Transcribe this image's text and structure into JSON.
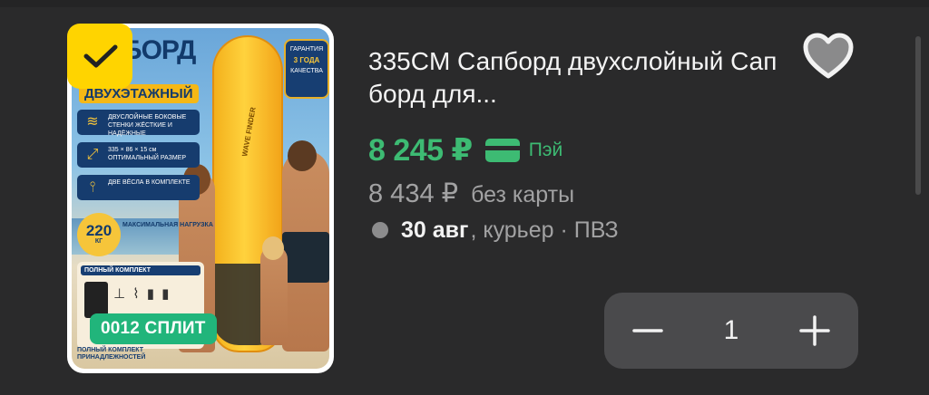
{
  "product": {
    "name": "335CM Сапборд двухслойный Сап борд для...",
    "price": "8 245 ₽",
    "pay_label": "Пэй",
    "old_price": "8 434 ₽",
    "old_price_label": "без карты",
    "delivery_date": "30 авг",
    "delivery_methods": ", курьер · ПВЗ",
    "split_badge": "0012 СПЛИТ",
    "quantity": "1"
  },
  "image": {
    "title_main": "БОРД",
    "title_sub": "ДВУХЭТАЖНЫЙ",
    "guarantee_top": "ГАРАНТИЯ",
    "guarantee_value": "3 ГОДА",
    "guarantee_bottom": "КАЧЕСТВА",
    "feature1": "ДВУСЛОЙНЫЕ БОКОВЫЕ СТЕНКИ ЖЁСТКИЕ И НАДЁЖНЫЕ",
    "feature2": "335 × 86 × 15 см ОПТИМАЛЬНЫЙ РАЗМЕР",
    "feature3": "ДВЕ ВЁСЛА В КОМПЛЕКТЕ",
    "weight_value": "220",
    "weight_unit": "КГ",
    "weight_label": "МАКСИМАЛЬНАЯ НАГРУЗКА",
    "kit_title": "ПОЛНЫЙ КОМПЛЕКТ",
    "kit_footer": "ПОЛНЫЙ КОМПЛЕКТ ПРИНАДЛЕЖНОСТЕЙ",
    "board_label": "WAVE FINDER"
  },
  "icons": {
    "check": "check-icon",
    "favorite": "heart-outline-icon",
    "minus": "minus-icon",
    "plus": "plus-icon",
    "pay": "card-icon"
  },
  "colors": {
    "background": "#2a2a2b",
    "price_green": "#3dbb73",
    "badge_yellow": "#ffd400",
    "split_green": "#21b57b",
    "stepper_bg": "#4a4a4c"
  }
}
